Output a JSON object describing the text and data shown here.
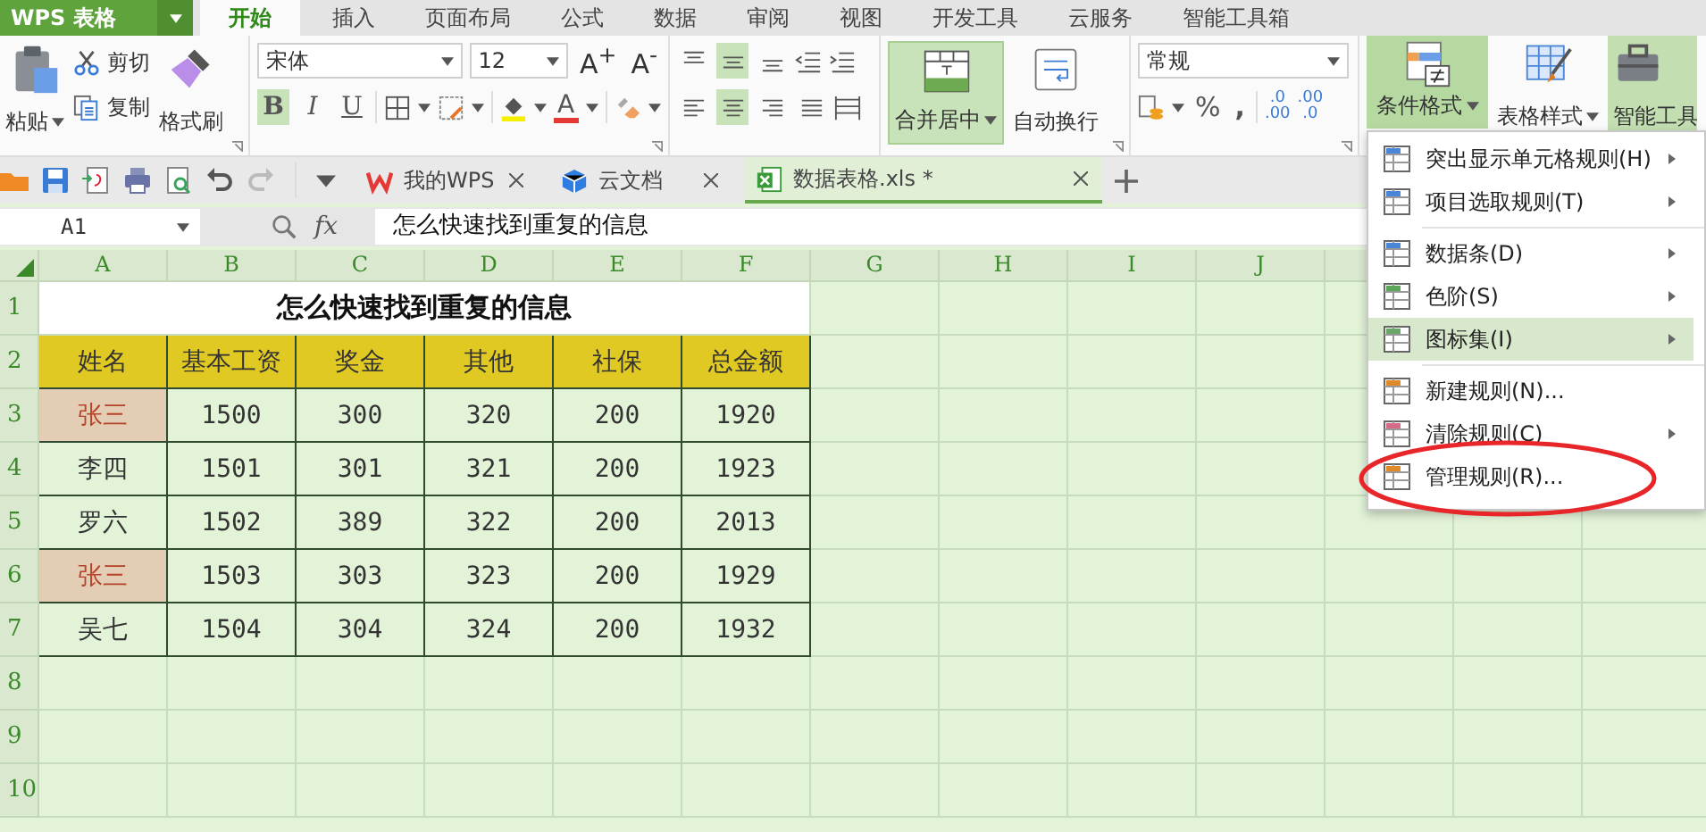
{
  "app_menu": {
    "label": "WPS 表格"
  },
  "menu_tabs": [
    {
      "label": "开始",
      "selected": true
    },
    {
      "label": "插入",
      "selected": false
    },
    {
      "label": "页面布局",
      "selected": false
    },
    {
      "label": "公式",
      "selected": false
    },
    {
      "label": "数据",
      "selected": false
    },
    {
      "label": "审阅",
      "selected": false
    },
    {
      "label": "视图",
      "selected": false
    },
    {
      "label": "开发工具",
      "selected": false
    },
    {
      "label": "云服务",
      "selected": false
    },
    {
      "label": "智能工具箱",
      "selected": false
    }
  ],
  "ribbon": {
    "paste": "粘贴",
    "cut": "剪切",
    "copy": "复制",
    "format_painter": "格式刷",
    "font_name": "宋体",
    "font_size": "12",
    "font_size_buttons": [
      "A$^{+}$",
      "A$^{-}$"
    ],
    "style_buttons": [
      {
        "label": "B",
        "selected": true
      },
      {
        "label": "I",
        "selected": false
      },
      {
        "label": "U",
        "selected": false
      }
    ],
    "font_color": "A",
    "vertical_align": [
      {
        "selected": false
      },
      {
        "selected": true
      },
      {
        "selected": false
      }
    ],
    "horizontal_align": [
      {
        "selected": false
      },
      {
        "selected": true
      },
      {
        "selected": false
      },
      {
        "selected": false
      }
    ],
    "merge_center": {
      "label": "合并居中",
      "selected": true
    },
    "wrap_text": "自动换行",
    "number_format": "常规",
    "percent": "%",
    "comma": ",",
    "decimal_buttons": [
      [
        ".0",
        ".00"
      ],
      [
        ".00",
        ".0"
      ]
    ],
    "conditional_format": {
      "label": "条件格式",
      "selected": true
    },
    "table_style": "表格样式",
    "smart_tools": "智能工具"
  },
  "doc_tabs": [
    {
      "label": "我的WPS",
      "kind": "wps",
      "selected": false
    },
    {
      "label": "云文档",
      "kind": "cloud",
      "selected": false
    },
    {
      "label": "数据表格.xls *",
      "kind": "sheet",
      "selected": true
    }
  ],
  "formula_bar": {
    "cell": "A1",
    "fx": "fx",
    "value": "怎么快速找到重复的信息"
  },
  "sheet": {
    "columns": [
      "A",
      "B",
      "C",
      "D",
      "E",
      "F",
      "G",
      "H",
      "I",
      "J"
    ],
    "row_numbers": [
      "1",
      "2",
      "3",
      "4",
      "5",
      "6",
      "7",
      "8",
      "9",
      "10"
    ],
    "title": "怎么快速找到重复的信息",
    "headers": [
      "姓名",
      "基本工资",
      "奖金",
      "其他",
      "社保",
      "总金额"
    ],
    "rows": [
      {
        "cells": [
          "张三",
          "1500",
          "300",
          "320",
          "200",
          "1920"
        ],
        "duplicate": true
      },
      {
        "cells": [
          "李四",
          "1501",
          "301",
          "321",
          "200",
          "1923"
        ],
        "duplicate": false
      },
      {
        "cells": [
          "罗六",
          "1502",
          "389",
          "322",
          "200",
          "2013"
        ],
        "duplicate": false
      },
      {
        "cells": [
          "张三",
          "1503",
          "303",
          "323",
          "200",
          "1929"
        ],
        "duplicate": true
      },
      {
        "cells": [
          "吴七",
          "1504",
          "304",
          "324",
          "200",
          "1932"
        ],
        "duplicate": false
      }
    ]
  },
  "context_menu": {
    "items": [
      {
        "label": "突出显示单元格规则(H)",
        "submenu": true,
        "selected": false,
        "separator_before": false,
        "circled": false
      },
      {
        "label": "项目选取规则(T)",
        "submenu": true,
        "selected": false,
        "separator_before": false,
        "circled": false
      },
      {
        "label": "数据条(D)",
        "submenu": true,
        "selected": false,
        "separator_before": true,
        "circled": false
      },
      {
        "label": "色阶(S)",
        "submenu": true,
        "selected": false,
        "separator_before": false,
        "circled": false
      },
      {
        "label": "图标集(I)",
        "submenu": true,
        "selected": true,
        "separator_before": false,
        "circled": false
      },
      {
        "label": "新建规则(N)...",
        "submenu": false,
        "selected": false,
        "separator_before": true,
        "circled": false
      },
      {
        "label": "清除规则(C)",
        "submenu": true,
        "selected": false,
        "separator_before": false,
        "circled": false
      },
      {
        "label": "管理规则(R)...",
        "submenu": false,
        "selected": false,
        "separator_before": false,
        "circled": true
      }
    ]
  }
}
